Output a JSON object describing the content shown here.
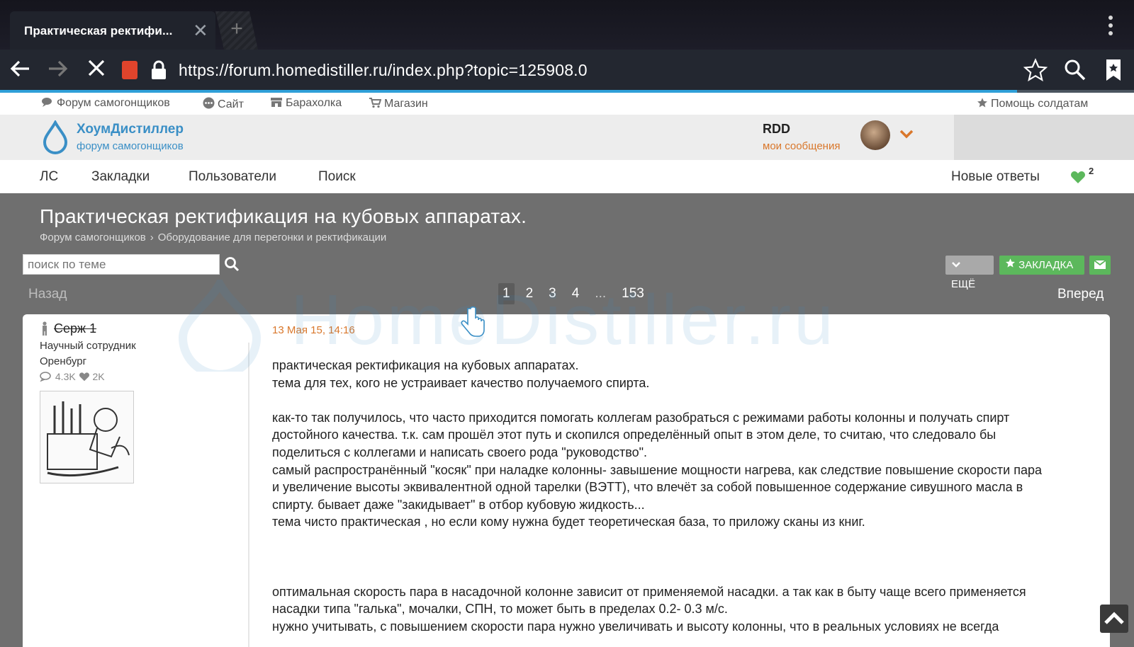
{
  "browser": {
    "tab_title": "Практическая ректифи...",
    "url": "https://forum.homedistiller.ru/index.php?topic=125908.0",
    "load_progress": 0.9
  },
  "topnav": {
    "forum": "Форум самогонщиков",
    "site": "Сайт",
    "market": "Барахолка",
    "shop": "Магазин",
    "help": "Помощь солдатам"
  },
  "header": {
    "site_name": "ХоумДистиллер",
    "site_sub": "форум самогонщиков",
    "username": "RDD",
    "my_messages": "мои сообщения"
  },
  "mainnav": {
    "pm": "ЛС",
    "bookmarks": "Закладки",
    "users": "Пользователи",
    "search": "Поиск",
    "new_replies": "Новые ответы",
    "likes_count": "2"
  },
  "topic": {
    "title": "Практическая ректификация на кубовых аппаратах.",
    "breadcrumb_1": "Форум самогонщиков",
    "breadcrumb_2": "Оборудование для перегонки и ректификации",
    "search_placeholder": "поиск по теме",
    "more_button": "ЕЩЁ",
    "bookmark_button": "ЗАКЛАДКА"
  },
  "pager": {
    "back": "Назад",
    "forward": "Вперед",
    "pages": [
      "1",
      "2",
      "3",
      "4"
    ],
    "ellipsis": "...",
    "last": "153",
    "current": "1"
  },
  "watermark": "HomeDistiller.ru",
  "post": {
    "author": "Серж 1",
    "role": "Научный сотрудник",
    "city": "Оренбург",
    "posts_count": "4.3K",
    "likes_count": "2K",
    "date": "13 Мая 15, 14:16",
    "lines": [
      "практическая ректификация на кубовых аппаратах.",
      "тема для тех, кого не устраивает качество получаемого спирта.",
      "",
      "как-то так получилось, что часто приходится помогать коллегам  разобраться с режимами работы колонны и получать спирт",
      "достойного качества. т.к. сам прошёл этот путь и скопился определённый опыт в этом деле, то считаю, что следовало бы",
      "поделиться с коллегами и написать своего рода \"руководство\".",
      "самый распространённый \"косяк\" при наладке колонны- завышение мощности нагрева, как следствие повышение скорости пара",
      "и увеличение высоты эквивалентной одной тарелки (ВЭТТ), что влечёт за собой повышенное содержание сивушного масла в",
      "спирту. бывает даже \"закидывает\" в отбор кубовую жидкость...",
      "тема чисто практическая , но если кому нужна будет теоретическая база, то приложу сканы из книг.",
      "",
      "",
      "",
      "оптимальная скорость пара в насадочной колонне зависит от применяемой насадки. а так как в быту чаще всего применяется",
      "насадки типа \"галька\", мочалки, СПН, то  может быть в пределах 0.2- 0.3 м/с.",
      "нужно учитывать,  с повышением скорости пара нужно увеличивать и высоту колонны, что в реальных условиях не всегда"
    ]
  },
  "colors": {
    "accent_blue": "#3a8fc6",
    "accent_orange": "#d9772b",
    "green": "#5cb85c",
    "page_bg": "#6f6f6f"
  }
}
